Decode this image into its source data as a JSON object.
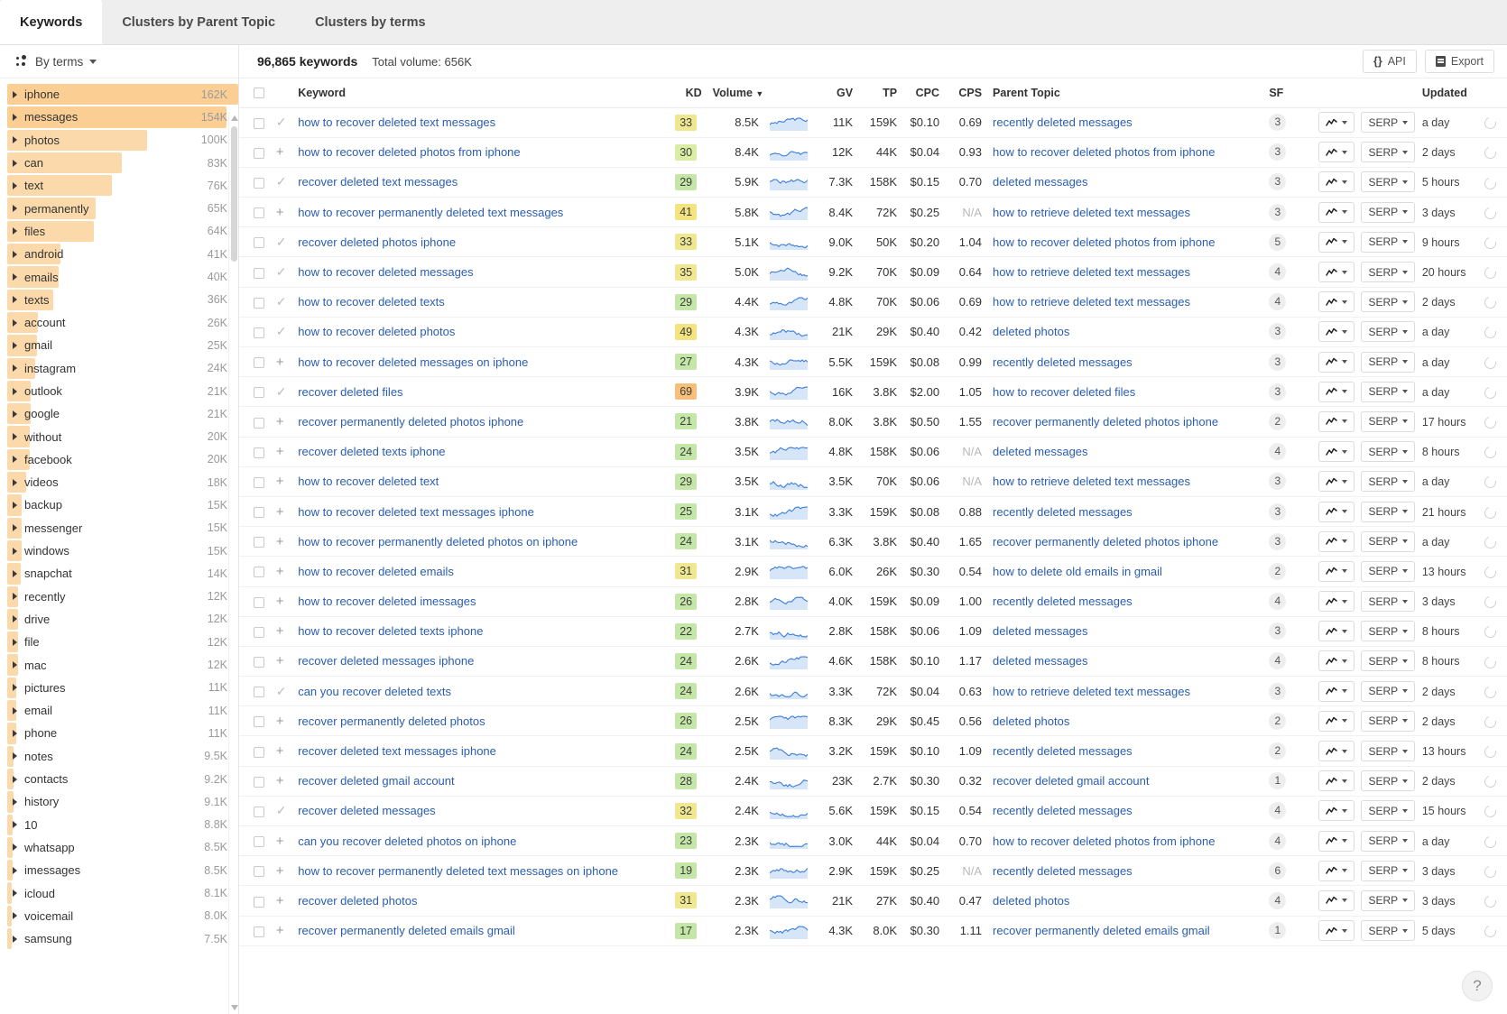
{
  "tabs": [
    {
      "label": "Keywords",
      "active": true
    },
    {
      "label": "Clusters by Parent Topic",
      "active": false
    },
    {
      "label": "Clusters by terms",
      "active": false
    }
  ],
  "sidebar": {
    "group_by_label": "By terms",
    "max_count": 162,
    "items": [
      {
        "label": "iphone",
        "count": "162K",
        "value": 162
      },
      {
        "label": "messages",
        "count": "154K",
        "value": 154
      },
      {
        "label": "photos",
        "count": "100K",
        "value": 100
      },
      {
        "label": "can",
        "count": "83K",
        "value": 83
      },
      {
        "label": "text",
        "count": "76K",
        "value": 76
      },
      {
        "label": "permanently",
        "count": "65K",
        "value": 65
      },
      {
        "label": "files",
        "count": "64K",
        "value": 64
      },
      {
        "label": "android",
        "count": "41K",
        "value": 41
      },
      {
        "label": "emails",
        "count": "40K",
        "value": 40
      },
      {
        "label": "texts",
        "count": "36K",
        "value": 36
      },
      {
        "label": "account",
        "count": "26K",
        "value": 26
      },
      {
        "label": "gmail",
        "count": "25K",
        "value": 25
      },
      {
        "label": "instagram",
        "count": "24K",
        "value": 24
      },
      {
        "label": "outlook",
        "count": "21K",
        "value": 21
      },
      {
        "label": "google",
        "count": "21K",
        "value": 21
      },
      {
        "label": "without",
        "count": "20K",
        "value": 20
      },
      {
        "label": "facebook",
        "count": "20K",
        "value": 20
      },
      {
        "label": "videos",
        "count": "18K",
        "value": 18
      },
      {
        "label": "backup",
        "count": "15K",
        "value": 15
      },
      {
        "label": "messenger",
        "count": "15K",
        "value": 15
      },
      {
        "label": "windows",
        "count": "15K",
        "value": 15
      },
      {
        "label": "snapchat",
        "count": "14K",
        "value": 14
      },
      {
        "label": "recently",
        "count": "12K",
        "value": 12
      },
      {
        "label": "drive",
        "count": "12K",
        "value": 12
      },
      {
        "label": "file",
        "count": "12K",
        "value": 12
      },
      {
        "label": "mac",
        "count": "12K",
        "value": 12
      },
      {
        "label": "pictures",
        "count": "11K",
        "value": 11
      },
      {
        "label": "email",
        "count": "11K",
        "value": 11
      },
      {
        "label": "phone",
        "count": "11K",
        "value": 11
      },
      {
        "label": "notes",
        "count": "9.5K",
        "value": 9.5
      },
      {
        "label": "contacts",
        "count": "9.2K",
        "value": 9.2
      },
      {
        "label": "history",
        "count": "9.1K",
        "value": 9.1
      },
      {
        "label": "10",
        "count": "8.8K",
        "value": 8.8
      },
      {
        "label": "whatsapp",
        "count": "8.5K",
        "value": 8.5
      },
      {
        "label": "imessages",
        "count": "8.5K",
        "value": 8.5
      },
      {
        "label": "icloud",
        "count": "8.1K",
        "value": 8.1
      },
      {
        "label": "voicemail",
        "count": "8.0K",
        "value": 8.0
      },
      {
        "label": "samsung",
        "count": "7.5K",
        "value": 7.5
      }
    ]
  },
  "toolbar": {
    "keywords_count": "96,865 keywords",
    "total_volume": "Total volume: 656K",
    "api_label": "API",
    "export_label": "Export"
  },
  "table": {
    "columns": {
      "keyword": "Keyword",
      "kd": "KD",
      "volume": "Volume",
      "gv": "GV",
      "tp": "TP",
      "cpc": "CPC",
      "cps": "CPS",
      "parent_topic": "Parent Topic",
      "sf": "SF",
      "updated": "Updated"
    },
    "sorted_by": "volume",
    "trend_button_label": "",
    "serp_button_label": "SERP",
    "rows": [
      {
        "mark": "check",
        "keyword": "how to recover deleted text messages",
        "kd": 33,
        "kd_class": "kd-y",
        "volume": "8.5K",
        "gv": "11K",
        "tp": "159K",
        "cpc": "$0.10",
        "cps": "0.69",
        "parent_topic": "recently deleted messages",
        "sf": "3",
        "updated": "a day"
      },
      {
        "mark": "plus",
        "keyword": "how to recover deleted photos from iphone",
        "kd": 30,
        "kd_class": "kd-g2",
        "volume": "8.4K",
        "gv": "12K",
        "tp": "44K",
        "cpc": "$0.04",
        "cps": "0.93",
        "parent_topic": "how to recover deleted photos from iphone",
        "sf": "3",
        "updated": "2 days"
      },
      {
        "mark": "check",
        "keyword": "recover deleted text messages",
        "kd": 29,
        "kd_class": "kd-g",
        "volume": "5.9K",
        "gv": "7.3K",
        "tp": "158K",
        "cpc": "$0.15",
        "cps": "0.70",
        "parent_topic": "deleted messages",
        "sf": "3",
        "updated": "5 hours"
      },
      {
        "mark": "plus",
        "keyword": "how to recover permanently deleted text messages",
        "kd": 41,
        "kd_class": "kd-y2",
        "volume": "5.8K",
        "gv": "8.4K",
        "tp": "72K",
        "cpc": "$0.25",
        "cps": "N/A",
        "parent_topic": "how to retrieve deleted text messages",
        "sf": "3",
        "updated": "3 days"
      },
      {
        "mark": "check",
        "keyword": "recover deleted photos iphone",
        "kd": 33,
        "kd_class": "kd-y",
        "volume": "5.1K",
        "gv": "9.0K",
        "tp": "50K",
        "cpc": "$0.20",
        "cps": "1.04",
        "parent_topic": "how to recover deleted photos from iphone",
        "sf": "5",
        "updated": "9 hours"
      },
      {
        "mark": "check",
        "keyword": "how to recover deleted messages",
        "kd": 35,
        "kd_class": "kd-y",
        "volume": "5.0K",
        "gv": "9.2K",
        "tp": "70K",
        "cpc": "$0.09",
        "cps": "0.64",
        "parent_topic": "how to retrieve deleted text messages",
        "sf": "4",
        "updated": "20 hours"
      },
      {
        "mark": "check",
        "keyword": "how to recover deleted texts",
        "kd": 29,
        "kd_class": "kd-g",
        "volume": "4.4K",
        "gv": "4.8K",
        "tp": "70K",
        "cpc": "$0.06",
        "cps": "0.69",
        "parent_topic": "how to retrieve deleted text messages",
        "sf": "4",
        "updated": "2 days"
      },
      {
        "mark": "check",
        "keyword": "how to recover deleted photos",
        "kd": 49,
        "kd_class": "kd-y2",
        "volume": "4.3K",
        "gv": "21K",
        "tp": "29K",
        "cpc": "$0.40",
        "cps": "0.42",
        "parent_topic": "deleted photos",
        "sf": "3",
        "updated": "a day"
      },
      {
        "mark": "plus",
        "keyword": "how to recover deleted messages on iphone",
        "kd": 27,
        "kd_class": "kd-g",
        "volume": "4.3K",
        "gv": "5.5K",
        "tp": "159K",
        "cpc": "$0.08",
        "cps": "0.99",
        "parent_topic": "recently deleted messages",
        "sf": "3",
        "updated": "a day"
      },
      {
        "mark": "check",
        "keyword": "recover deleted files",
        "kd": 69,
        "kd_class": "kd-o",
        "volume": "3.9K",
        "gv": "16K",
        "tp": "3.8K",
        "cpc": "$2.00",
        "cps": "1.05",
        "parent_topic": "how to recover deleted files",
        "sf": "3",
        "updated": "a day"
      },
      {
        "mark": "plus",
        "keyword": "recover permanently deleted photos iphone",
        "kd": 21,
        "kd_class": "kd-g",
        "volume": "3.8K",
        "gv": "8.0K",
        "tp": "3.8K",
        "cpc": "$0.50",
        "cps": "1.55",
        "parent_topic": "recover permanently deleted photos iphone",
        "sf": "2",
        "updated": "17 hours"
      },
      {
        "mark": "plus",
        "keyword": "recover deleted texts iphone",
        "kd": 24,
        "kd_class": "kd-g",
        "volume": "3.5K",
        "gv": "4.8K",
        "tp": "158K",
        "cpc": "$0.06",
        "cps": "N/A",
        "parent_topic": "deleted messages",
        "sf": "4",
        "updated": "8 hours"
      },
      {
        "mark": "plus",
        "keyword": "how to recover deleted text",
        "kd": 29,
        "kd_class": "kd-g",
        "volume": "3.5K",
        "gv": "3.5K",
        "tp": "70K",
        "cpc": "$0.06",
        "cps": "N/A",
        "parent_topic": "how to retrieve deleted text messages",
        "sf": "3",
        "updated": "a day"
      },
      {
        "mark": "plus",
        "keyword": "how to recover deleted text messages iphone",
        "kd": 25,
        "kd_class": "kd-g",
        "volume": "3.1K",
        "gv": "3.3K",
        "tp": "159K",
        "cpc": "$0.08",
        "cps": "0.88",
        "parent_topic": "recently deleted messages",
        "sf": "3",
        "updated": "21 hours"
      },
      {
        "mark": "plus",
        "keyword": "how to recover permanently deleted photos on iphone",
        "kd": 24,
        "kd_class": "kd-g",
        "volume": "3.1K",
        "gv": "6.3K",
        "tp": "3.8K",
        "cpc": "$0.40",
        "cps": "1.65",
        "parent_topic": "recover permanently deleted photos iphone",
        "sf": "3",
        "updated": "a day"
      },
      {
        "mark": "plus",
        "keyword": "how to recover deleted emails",
        "kd": 31,
        "kd_class": "kd-y",
        "volume": "2.9K",
        "gv": "6.0K",
        "tp": "26K",
        "cpc": "$0.30",
        "cps": "0.54",
        "parent_topic": "how to delete old emails in gmail",
        "sf": "2",
        "updated": "13 hours"
      },
      {
        "mark": "plus",
        "keyword": "how to recover deleted imessages",
        "kd": 26,
        "kd_class": "kd-g",
        "volume": "2.8K",
        "gv": "4.0K",
        "tp": "159K",
        "cpc": "$0.09",
        "cps": "1.00",
        "parent_topic": "recently deleted messages",
        "sf": "4",
        "updated": "3 days"
      },
      {
        "mark": "plus",
        "keyword": "how to recover deleted texts iphone",
        "kd": 22,
        "kd_class": "kd-g",
        "volume": "2.7K",
        "gv": "2.8K",
        "tp": "158K",
        "cpc": "$0.06",
        "cps": "1.09",
        "parent_topic": "deleted messages",
        "sf": "3",
        "updated": "8 hours"
      },
      {
        "mark": "plus",
        "keyword": "recover deleted messages iphone",
        "kd": 24,
        "kd_class": "kd-g",
        "volume": "2.6K",
        "gv": "4.6K",
        "tp": "158K",
        "cpc": "$0.10",
        "cps": "1.17",
        "parent_topic": "deleted messages",
        "sf": "4",
        "updated": "8 hours"
      },
      {
        "mark": "check",
        "keyword": "can you recover deleted texts",
        "kd": 24,
        "kd_class": "kd-g",
        "volume": "2.6K",
        "gv": "3.3K",
        "tp": "72K",
        "cpc": "$0.04",
        "cps": "0.63",
        "parent_topic": "how to retrieve deleted text messages",
        "sf": "3",
        "updated": "2 days"
      },
      {
        "mark": "plus",
        "keyword": "recover permanently deleted photos",
        "kd": 26,
        "kd_class": "kd-g",
        "volume": "2.5K",
        "gv": "8.3K",
        "tp": "29K",
        "cpc": "$0.45",
        "cps": "0.56",
        "parent_topic": "deleted photos",
        "sf": "2",
        "updated": "2 days"
      },
      {
        "mark": "plus",
        "keyword": "recover deleted text messages iphone",
        "kd": 24,
        "kd_class": "kd-g",
        "volume": "2.5K",
        "gv": "3.2K",
        "tp": "159K",
        "cpc": "$0.10",
        "cps": "1.09",
        "parent_topic": "recently deleted messages",
        "sf": "2",
        "updated": "13 hours"
      },
      {
        "mark": "plus",
        "keyword": "recover deleted gmail account",
        "kd": 28,
        "kd_class": "kd-g",
        "volume": "2.4K",
        "gv": "23K",
        "tp": "2.7K",
        "cpc": "$0.30",
        "cps": "0.32",
        "parent_topic": "recover deleted gmail account",
        "sf": "1",
        "updated": "2 days"
      },
      {
        "mark": "check",
        "keyword": "recover deleted messages",
        "kd": 32,
        "kd_class": "kd-y",
        "volume": "2.4K",
        "gv": "5.6K",
        "tp": "159K",
        "cpc": "$0.15",
        "cps": "0.54",
        "parent_topic": "recently deleted messages",
        "sf": "4",
        "updated": "15 hours"
      },
      {
        "mark": "plus",
        "keyword": "can you recover deleted photos on iphone",
        "kd": 23,
        "kd_class": "kd-g",
        "volume": "2.3K",
        "gv": "3.0K",
        "tp": "44K",
        "cpc": "$0.04",
        "cps": "0.70",
        "parent_topic": "how to recover deleted photos from iphone",
        "sf": "4",
        "updated": "a day"
      },
      {
        "mark": "plus",
        "keyword": "how to recover permanently deleted text messages on iphone",
        "kd": 19,
        "kd_class": "kd-g",
        "volume": "2.3K",
        "gv": "2.9K",
        "tp": "159K",
        "cpc": "$0.25",
        "cps": "N/A",
        "parent_topic": "recently deleted messages",
        "sf": "6",
        "updated": "3 days"
      },
      {
        "mark": "plus",
        "keyword": "recover deleted photos",
        "kd": 31,
        "kd_class": "kd-y",
        "volume": "2.3K",
        "gv": "21K",
        "tp": "27K",
        "cpc": "$0.40",
        "cps": "0.47",
        "parent_topic": "deleted photos",
        "sf": "4",
        "updated": "3 days"
      },
      {
        "mark": "plus",
        "keyword": "recover permanently deleted emails gmail",
        "kd": 17,
        "kd_class": "kd-g",
        "volume": "2.3K",
        "gv": "4.3K",
        "tp": "8.0K",
        "cpc": "$0.30",
        "cps": "1.11",
        "parent_topic": "recover permanently deleted emails gmail",
        "sf": "1",
        "updated": "5 days"
      }
    ]
  },
  "help": {
    "label": "?"
  }
}
